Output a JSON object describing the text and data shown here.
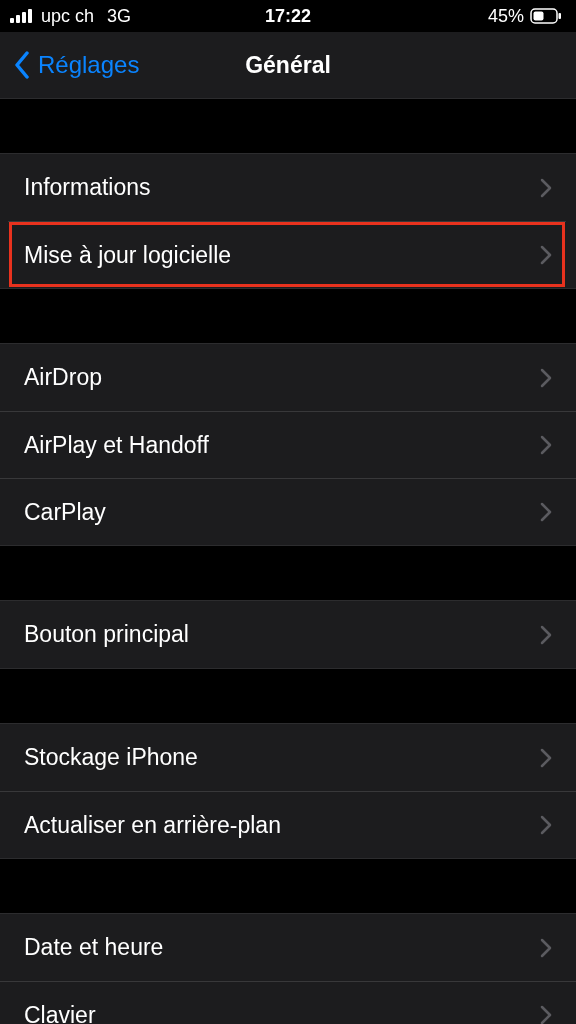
{
  "status_bar": {
    "carrier": "upc ch",
    "network": "3G",
    "time": "17:22",
    "battery": "45%"
  },
  "nav": {
    "back": "Réglages",
    "title": "Général"
  },
  "groups": [
    {
      "items": [
        {
          "label": "Informations",
          "highlighted": false
        },
        {
          "label": "Mise à jour logicielle",
          "highlighted": true
        }
      ]
    },
    {
      "items": [
        {
          "label": "AirDrop",
          "highlighted": false
        },
        {
          "label": "AirPlay et Handoff",
          "highlighted": false
        },
        {
          "label": "CarPlay",
          "highlighted": false
        }
      ]
    },
    {
      "items": [
        {
          "label": "Bouton principal",
          "highlighted": false
        }
      ]
    },
    {
      "items": [
        {
          "label": "Stockage iPhone",
          "highlighted": false
        },
        {
          "label": "Actualiser en arrière-plan",
          "highlighted": false
        }
      ]
    },
    {
      "items": [
        {
          "label": "Date et heure",
          "highlighted": false
        },
        {
          "label": "Clavier",
          "highlighted": false
        }
      ]
    }
  ]
}
